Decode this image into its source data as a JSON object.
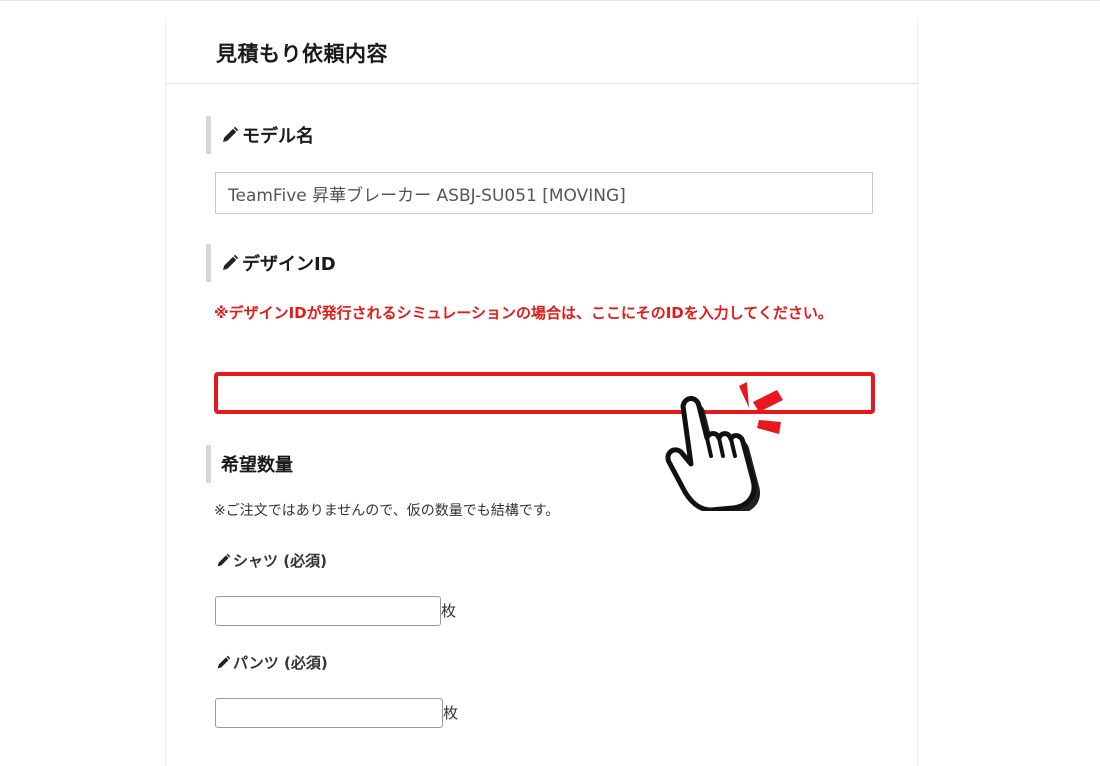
{
  "page": {
    "title": "見積もり依頼内容"
  },
  "model": {
    "label": "モデル名",
    "value": "TeamFive 昇華ブレーカー ASBJ-SU051 [MOVING]"
  },
  "design": {
    "label": "デザインID",
    "note": "※デザインIDが発行されるシミュレーションの場合は、ここにそのIDを入力してください。",
    "value": ""
  },
  "quantity": {
    "label": "希望数量",
    "note": "※ご注文ではありませんので、仮の数量でも結構です。",
    "shirt_label": "シャツ (必須)",
    "shirt_value": "",
    "shirt_unit": "枚",
    "pants_label": "パンツ (必須)",
    "pants_value": "",
    "pants_unit": "枚"
  },
  "icons": {
    "pencil": "pencil-icon",
    "pointer": "pointing-hand-icon"
  },
  "colors": {
    "highlight": "#e8161d",
    "note_red": "#e11a1a",
    "section_bar": "#d7d7d7"
  }
}
